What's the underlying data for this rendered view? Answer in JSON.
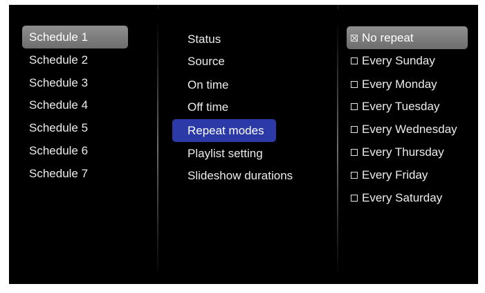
{
  "schedules": {
    "items": [
      {
        "label": "Schedule 1"
      },
      {
        "label": "Schedule 2"
      },
      {
        "label": "Schedule 3"
      },
      {
        "label": "Schedule 4"
      },
      {
        "label": "Schedule 5"
      },
      {
        "label": "Schedule 6"
      },
      {
        "label": "Schedule 7"
      }
    ]
  },
  "settings": {
    "items": [
      {
        "label": "Status"
      },
      {
        "label": "Source"
      },
      {
        "label": "On time"
      },
      {
        "label": "Off time"
      },
      {
        "label": "Repeat modes"
      },
      {
        "label": "Playlist setting"
      },
      {
        "label": "Slideshow durations"
      }
    ]
  },
  "repeat_options": {
    "items": [
      {
        "label": "No repeat",
        "checked": true
      },
      {
        "label": "Every Sunday",
        "checked": false
      },
      {
        "label": "Every Monday",
        "checked": false
      },
      {
        "label": "Every Tuesday",
        "checked": false
      },
      {
        "label": "Every Wednesday",
        "checked": false
      },
      {
        "label": "Every Thursday",
        "checked": false
      },
      {
        "label": "Every Friday",
        "checked": false
      },
      {
        "label": "Every Saturday",
        "checked": false
      }
    ]
  },
  "colors": {
    "background": "#000000",
    "highlight": "#7e7e7e",
    "active": "#2b3aa6",
    "text": "#ececec"
  }
}
